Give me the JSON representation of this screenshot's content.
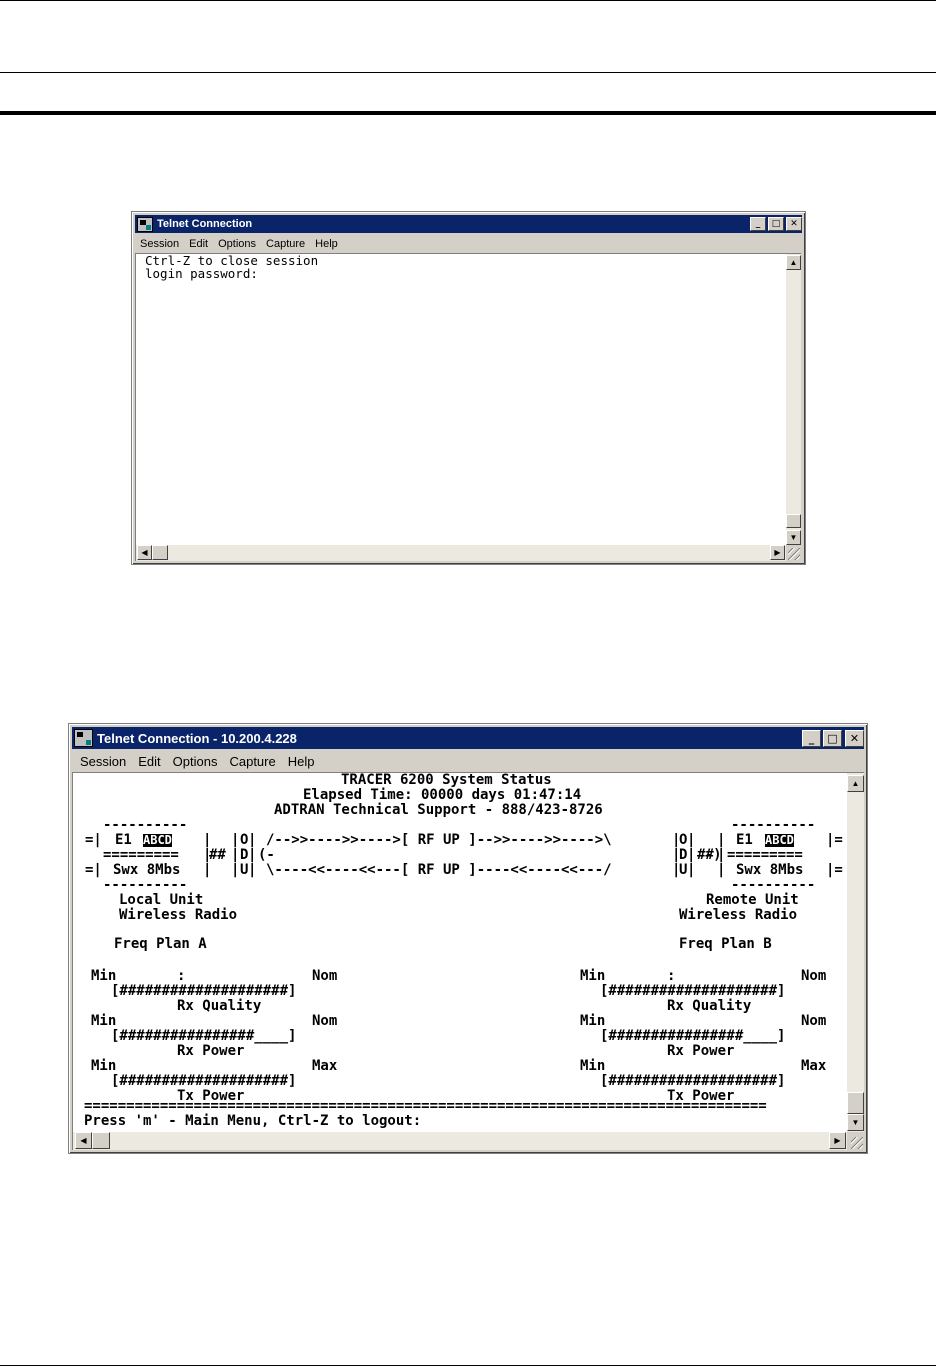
{
  "window1": {
    "title": "Telnet Connection",
    "menu": [
      "Session",
      "Edit",
      "Options",
      "Capture",
      "Help"
    ],
    "terminal": {
      "line1": "Ctrl-Z to close session",
      "line2": "login password:"
    }
  },
  "window2": {
    "title": "Telnet Connection - 10.200.4.228",
    "menu": [
      "Session",
      "Edit",
      "Options",
      "Capture",
      "Help"
    ],
    "header": {
      "title": "TRACER 6200 System Status",
      "elapsed": "Elapsed Time: 00000 days 01:47:14",
      "support": "ADTRAN Technical Support - 888/423-8726"
    },
    "link": {
      "local_e1": "E1",
      "local_abcd": "ABCD",
      "local_swx": "Swx 8Mbs",
      "remote_e1": "E1",
      "remote_abcd": "ABCD",
      "remote_swx": "Swx 8Mbs",
      "top_path": "/-->>---->>---->[ RF UP ]-->>---->>---->\\",
      "bottom_path": "\\----<<----<<---[ RF UP ]----<<----<<---/",
      "odu": [
        "O",
        "D",
        "U"
      ],
      "hash": "##",
      "separator": "=========",
      "dashes": "----------"
    },
    "local": {
      "unit": "Local Unit",
      "radio": "Wireless Radio",
      "freq": "Freq Plan A",
      "rx_quality": {
        "min": "Min",
        "mid": ":",
        "end": "Nom",
        "bar": "[####################]",
        "label": "Rx Quality"
      },
      "rx_power": {
        "min": "Min",
        "end": "Nom",
        "bar": "[################____]",
        "label": "Rx Power"
      },
      "tx_power": {
        "min": "Min",
        "end": "Max",
        "bar": "[####################]",
        "label": "Tx Power"
      }
    },
    "remote": {
      "unit": "Remote Unit",
      "radio": "Wireless Radio",
      "freq": "Freq Plan B",
      "rx_quality": {
        "min": "Min",
        "mid": ":",
        "end": "Nom",
        "bar": "[####################]",
        "label": "Rx Quality"
      },
      "rx_power": {
        "min": "Min",
        "end": "Nom",
        "bar": "[################____]",
        "label": "Rx Power"
      },
      "tx_power": {
        "min": "Min",
        "end": "Max",
        "bar": "[####################]",
        "label": "Tx Power"
      }
    },
    "divider": "=================================================================================",
    "prompt": "Press 'm' - Main Menu, Ctrl-Z to logout:"
  }
}
